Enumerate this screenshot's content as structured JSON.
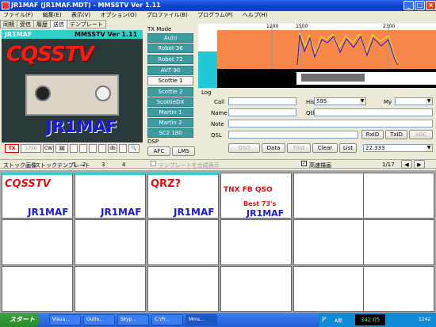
{
  "window": {
    "title": "JR1MAF (JR1MAF.MDT) - MMSSTV Ver 1.11",
    "minimize": "_",
    "maximize": "□",
    "close": "×"
  },
  "menu": [
    "ファイル(F)",
    "編集(E)",
    "表示(V)",
    "オプション(O)",
    "プロファイル(B)",
    "プログラム(P)",
    "ヘルプ(H)"
  ],
  "tabs": [
    "同期",
    "受信",
    "履歴",
    "送信",
    "テンプレート"
  ],
  "hero": {
    "left": "JR1MAF",
    "right": "MMSSTV Ver 1.11",
    "cq": "CQSSTV",
    "call": "JR1MAF"
  },
  "controls": {
    "tx": "TX",
    "freq": "1750",
    "cw": "CW",
    "pic": "🖼",
    "dbl": "db",
    "zoom": "🔍"
  },
  "tx_mode": {
    "label": "TX Mode",
    "modes": [
      "Auto",
      "Robot 36",
      "Robot 72",
      "AVT 90",
      "Scottie 1",
      "Scottie 2",
      "ScottieDX",
      "Martin 1",
      "Martin 2",
      "SC2 180"
    ],
    "selected": "Scottie 1"
  },
  "dsp": {
    "label": "DSP",
    "afc": "AFC",
    "lms": "LMS"
  },
  "spectrum": {
    "ticks": [
      "1200",
      "1500",
      "2300"
    ],
    "colors": {
      "bg": "#f8884a",
      "cyan": "#20c8d8",
      "trace": "#1a1ad8",
      "trace2": "#e8e820"
    }
  },
  "log": {
    "label": "Log",
    "call": "Call",
    "name": "Name",
    "note": "Note",
    "qsl": "QSL",
    "his": "His",
    "his_val": "595",
    "my": "My",
    "qth": "Qth",
    "rxid": "RxID",
    "txid": "TxID",
    "qso": "QSO",
    "data": "Data",
    "find": "Find",
    "clear": "Clear",
    "list": "List",
    "freq": "22.333",
    "qth_btn": "ABC"
  },
  "stock": {
    "label": "ストック画像",
    "template": "ストックテンプレート",
    "pages": [
      "1",
      "2",
      "3",
      "4"
    ],
    "compose": "テンプレートを合成表示",
    "fast": "高速描画",
    "page": "1/17"
  },
  "cells": [
    {
      "tl": "CQSSTV",
      "br": "JR1MAF"
    },
    {
      "tl": "",
      "br": "JR1MAF"
    },
    {
      "tl": "QRZ?",
      "br": "JR1MAF"
    },
    {
      "tl": "TNX FB QSO",
      "br": "JR1MAF",
      "mid": "Best 73's"
    },
    {
      "tl": "",
      "br": ""
    },
    {
      "tl": "",
      "br": ""
    }
  ],
  "taskbar": {
    "start": "スタート",
    "tasks": [
      "Visua...",
      "Outlo...",
      "Skyp...",
      "C:\\Pr...",
      "Mms..."
    ],
    "tray": [
      "JP",
      "A般",
      "342.05",
      "1242"
    ]
  }
}
